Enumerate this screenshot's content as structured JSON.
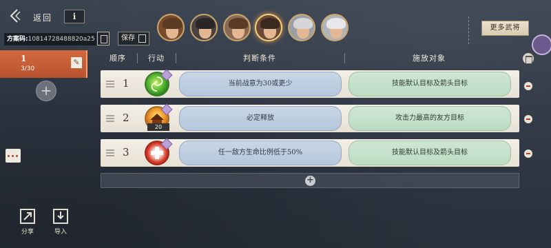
{
  "topbar": {
    "back_label": "返回",
    "info_glyph": "i",
    "plan_code_label": "方案码:",
    "plan_code_value": "10814728488820a25",
    "save_label": "保存",
    "more_generals_label": "更多武将"
  },
  "portraits": [
    {
      "hair": "#5a3a22",
      "bg": "#7a4a2c"
    },
    {
      "hair": "#2a2628",
      "bg": "#4a4240"
    },
    {
      "hair": "#5b3a26",
      "bg": "#8a6a52"
    },
    {
      "hair": "#3a2a20",
      "bg": "#6b4a38"
    },
    {
      "hair": "#d6d6d8",
      "bg": "#9aa0a8"
    },
    {
      "hair": "#e8e8ea",
      "bg": "#b0b4ba"
    }
  ],
  "plans": {
    "active_number": "1",
    "active_count": "3/30",
    "edit_glyph": "✎",
    "add_glyph": "+"
  },
  "table": {
    "headers": {
      "order": "顺序",
      "action": "行动",
      "condition": "判断条件",
      "target": "施放对象"
    },
    "rows": [
      {
        "index": "1",
        "skill_icon": "green-swirl-icon",
        "skill_level": "",
        "condition": "当前战意为30或更少",
        "target": "技能默认目标及箭头目标"
      },
      {
        "index": "2",
        "skill_icon": "golden-palace-icon",
        "skill_level": "20",
        "condition": "必定释放",
        "target": "攻击力最高的友方目标"
      },
      {
        "index": "3",
        "skill_icon": "red-cross-icon",
        "skill_level": "",
        "condition": "任一敌方生命比例低于50%",
        "target": "技能默认目标及箭头目标"
      }
    ],
    "add_glyph": "+"
  },
  "bottom": {
    "share_label": "分享",
    "import_label": "导入"
  },
  "colors": {
    "active_tab": "#c85d36",
    "condition_bg": "#c0d0e2",
    "target_bg": "#c6e1cc"
  }
}
